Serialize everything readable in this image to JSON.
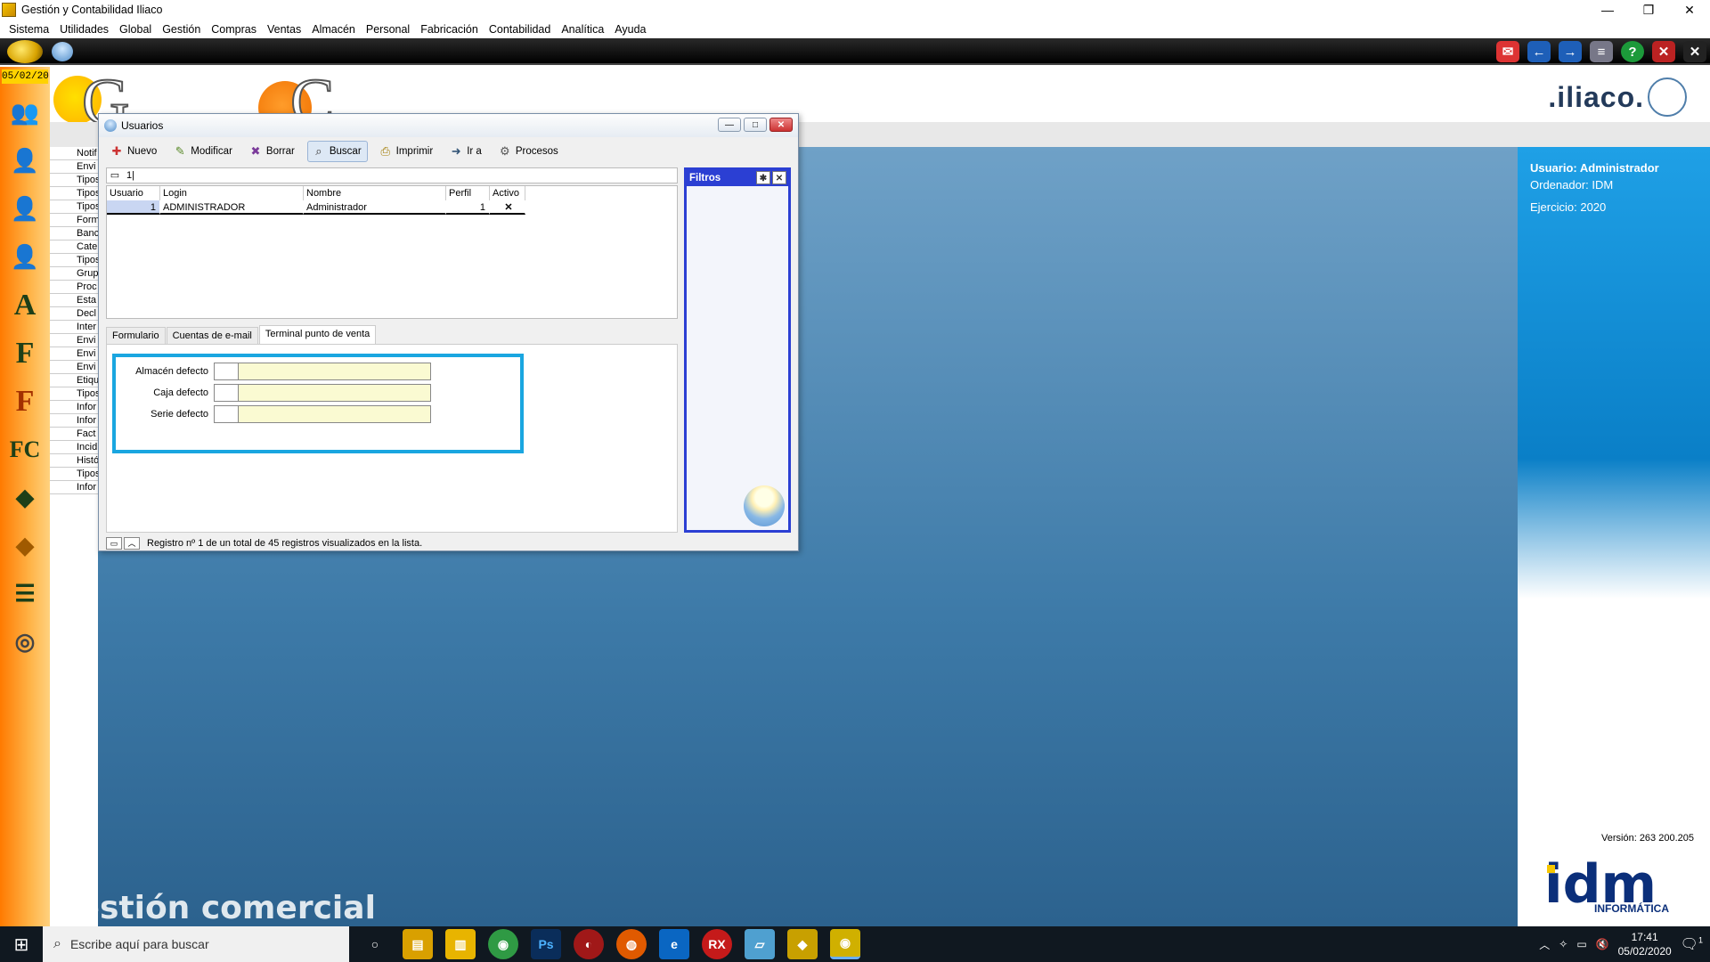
{
  "window": {
    "title": "Gestión y Contabilidad Iliaco",
    "minimize": "—",
    "restore": "❐",
    "close": "✕"
  },
  "menu": [
    "Sistema",
    "Utilidades",
    "Global",
    "Gestión",
    "Compras",
    "Ventas",
    "Almacén",
    "Personal",
    "Fabricación",
    "Contabilidad",
    "Analítica",
    "Ayuda"
  ],
  "sidebar": {
    "date": "05/02/20",
    "list_items": [
      "Notif",
      "Envi",
      "Tipos",
      "Tipos",
      "Tipos",
      "Form",
      "Banc",
      "Cate",
      "Tipos",
      "Grup",
      "Proc",
      "Esta",
      "Decl",
      "Inter",
      "Envi",
      "Envi",
      "Envi",
      "Etiqu",
      "Tipos",
      "Infor",
      "Infor",
      "Fact",
      "Incid",
      "Histó",
      "Tipos",
      "Infor"
    ]
  },
  "banner": {
    "letter1": "G",
    "letter2": "C",
    "brand": ".iliaco."
  },
  "main": {
    "bottom_title": "Gestión comercial"
  },
  "info_panel": {
    "user": "Usuario: Administrador",
    "computer": "Ordenador: IDM",
    "year": "Ejercicio: 2020",
    "version": "Versión: 263 200.205",
    "logo_letters": "idm",
    "logo_sub": "INFORMÁTICA"
  },
  "dialog": {
    "title": "Usuarios",
    "toolbar": {
      "nuevo": "Nuevo",
      "modificar": "Modificar",
      "borrar": "Borrar",
      "buscar": "Buscar",
      "imprimir": "Imprimir",
      "ir_a": "Ir a",
      "procesos": "Procesos"
    },
    "search_value": "1|",
    "grid": {
      "headers": [
        "Usuario",
        "Login",
        "Nombre",
        "Perfil",
        "Activo"
      ],
      "rows": [
        {
          "usuario": "1",
          "login": "ADMINISTRADOR",
          "nombre": "Administrador",
          "perfil": "1",
          "activo": "✕"
        }
      ]
    },
    "tabs": [
      "Formulario",
      "Cuentas de e-mail",
      "Terminal punto de venta"
    ],
    "fields": {
      "almacen": "Almacén defecto",
      "caja": "Caja defecto",
      "serie": "Serie defecto"
    },
    "filters_title": "Filtros",
    "status": "Registro nº 1 de un total de 45 registros visualizados en la lista."
  },
  "taskbar": {
    "search_placeholder": "Escribe aquí para buscar",
    "time": "17:41",
    "date": "05/02/2020",
    "notif_count": "1"
  },
  "colors": {
    "accent_blue": "#1aa6e0",
    "filters_blue": "#2b3fd3",
    "sidebar_orange": "#ff7a00"
  }
}
